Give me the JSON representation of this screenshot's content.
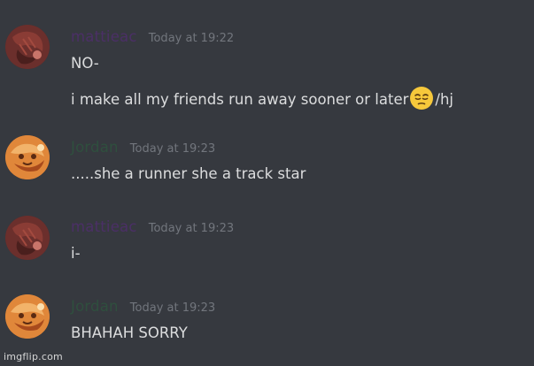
{
  "colors": {
    "background": "#36393f",
    "username_mattieac": "#4b2f66",
    "username_jordan": "#2f4f3e",
    "timestamp": "#72767d",
    "message_text": "#dcddde"
  },
  "messages": [
    {
      "username": "mattieac",
      "timestamp": "Today at 19:22",
      "avatar_icon": "dark-red-avatar-icon",
      "lines": [
        "NO-",
        "i make all my friends run away sooner or later",
        "/hj"
      ],
      "emoji": "pensive-face-emoji"
    },
    {
      "username": "Jordan",
      "timestamp": "Today at 19:23",
      "avatar_icon": "orange-avatar-icon",
      "lines": [
        ".....she a runner she a track star"
      ]
    },
    {
      "username": "mattieac",
      "timestamp": "Today at 19:23",
      "avatar_icon": "dark-red-avatar-icon",
      "lines": [
        "i-"
      ]
    },
    {
      "username": "Jordan",
      "timestamp": "Today at 19:23",
      "avatar_icon": "orange-avatar-icon",
      "lines": [
        "BHAHAH SORRY"
      ]
    }
  ],
  "watermark": "imgflip.com"
}
